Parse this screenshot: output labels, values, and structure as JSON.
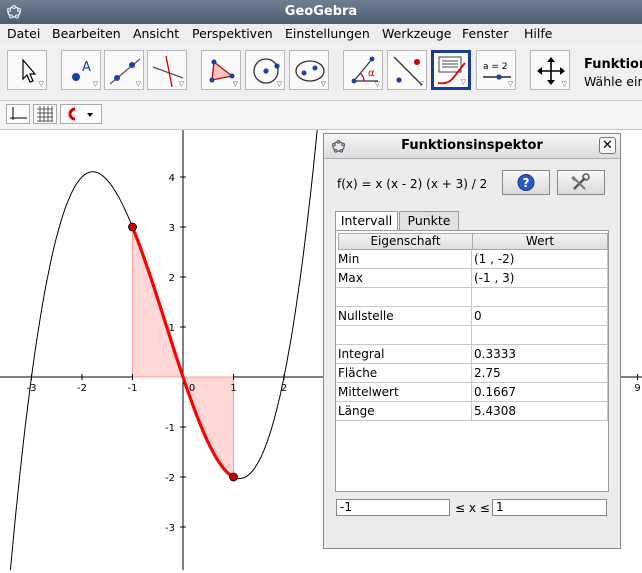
{
  "window": {
    "title": "GeoGebra"
  },
  "menu": [
    "Datei",
    "Bearbeiten",
    "Ansicht",
    "Perspektiven",
    "Einstellungen",
    "Werkzeuge",
    "Fenster",
    "Hilfe"
  ],
  "toolbar": {
    "tools": [
      {
        "icon": "move-tool-icon"
      },
      {
        "icon": "point-tool-icon",
        "label": "A"
      },
      {
        "icon": "line-tool-icon"
      },
      {
        "icon": "perpendicular-line-tool-icon"
      },
      {
        "icon": "polygon-tool-icon"
      },
      {
        "icon": "circle-tool-icon"
      },
      {
        "icon": "conic-tool-icon"
      },
      {
        "icon": "angle-tool-icon",
        "label": "α"
      },
      {
        "icon": "reflect-tool-icon"
      },
      {
        "icon": "function-inspector-tool-icon"
      },
      {
        "icon": "slider-tool-icon",
        "label": "a = 2"
      },
      {
        "icon": "move-graphics-view-tool-icon"
      }
    ],
    "tool_name": "Funktion",
    "tool_help": "Wähle ein"
  },
  "stylebar": {
    "buttons": [
      "axes-toggle-icon",
      "grid-toggle-icon",
      "point-capturing-icon"
    ]
  },
  "graphics": {
    "x_ticks": [
      "-3",
      "-2",
      "-1",
      "0",
      "1",
      "2",
      "9"
    ],
    "y_ticks": [
      "4",
      "3",
      "2",
      "1",
      "-1",
      "-2",
      "-3"
    ],
    "curve_color": "#000000",
    "highlight_color": "#ff0000",
    "fill_color": "#ffcccc",
    "f_expression": "x (x - 2) (x + 3) / 2",
    "interval": [
      -1,
      1
    ],
    "points": [
      {
        "x": -1,
        "y": 3
      },
      {
        "x": 1,
        "y": -2
      }
    ]
  },
  "inspector": {
    "title": "Funktionsinspektor",
    "function": "f(x) = x (x - 2) (x + 3) / 2",
    "help_icon": "help-icon",
    "settings_icon": "settings-tools-icon",
    "tabs": [
      "Intervall",
      "Punkte"
    ],
    "columns": [
      "Eigenschaft",
      "Wert"
    ],
    "rows": [
      {
        "name": "Min",
        "value": "(1 , -2)"
      },
      {
        "name": "Max",
        "value": "(-1 , 3)"
      },
      {
        "name": "",
        "value": ""
      },
      {
        "name": "Nullstelle",
        "value": "0"
      },
      {
        "name": "",
        "value": ""
      },
      {
        "name": "Integral",
        "value": "0.3333"
      },
      {
        "name": "Fläche",
        "value": "2.75"
      },
      {
        "name": "Mittelwert",
        "value": "0.1667"
      },
      {
        "name": "Länge",
        "value": "5.4308"
      }
    ],
    "interval_start": "-1",
    "interval_label": "≤ x ≤",
    "interval_end": "1"
  }
}
